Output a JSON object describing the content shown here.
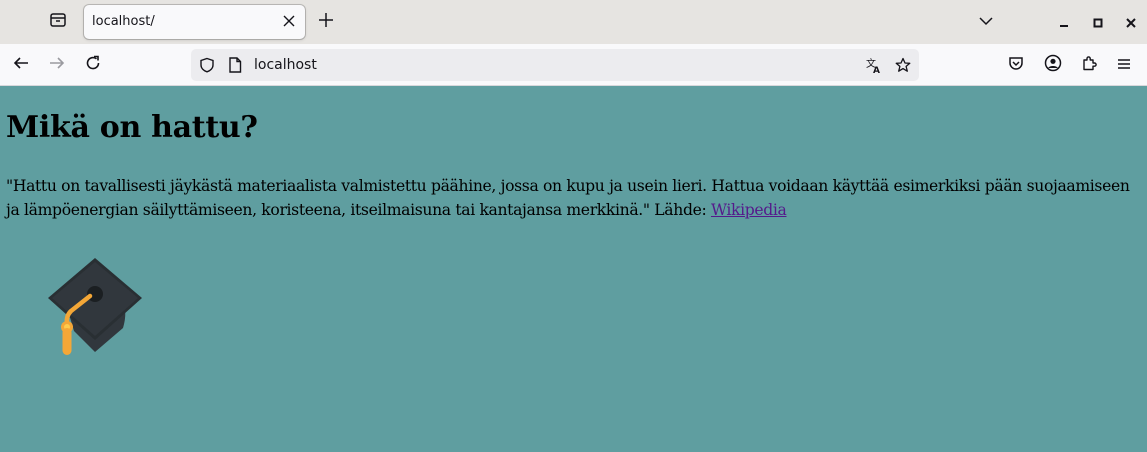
{
  "browser": {
    "tab": {
      "title": "localhost/"
    },
    "url": "localhost"
  },
  "page": {
    "heading": "Mikä on hattu?",
    "paragraph": "\"Hattu on tavallisesti jäykästä materiaalista valmistettu päähine, jossa on kupu ja usein lieri. Hattua voidaan käyttää esimerkiksi pään suojaamiseen ja lämpöenergian säilyttämiseen, koristeena, itseilmaisuna tai kantajansa merkkinä.\" Lähde: ",
    "link_text": "Wikipedia",
    "image_icon": "graduation-cap-icon"
  },
  "colors": {
    "page_background": "#5f9ea0",
    "link": "#551a8b",
    "cap": "#31373d",
    "tassel": "#f4a737"
  }
}
